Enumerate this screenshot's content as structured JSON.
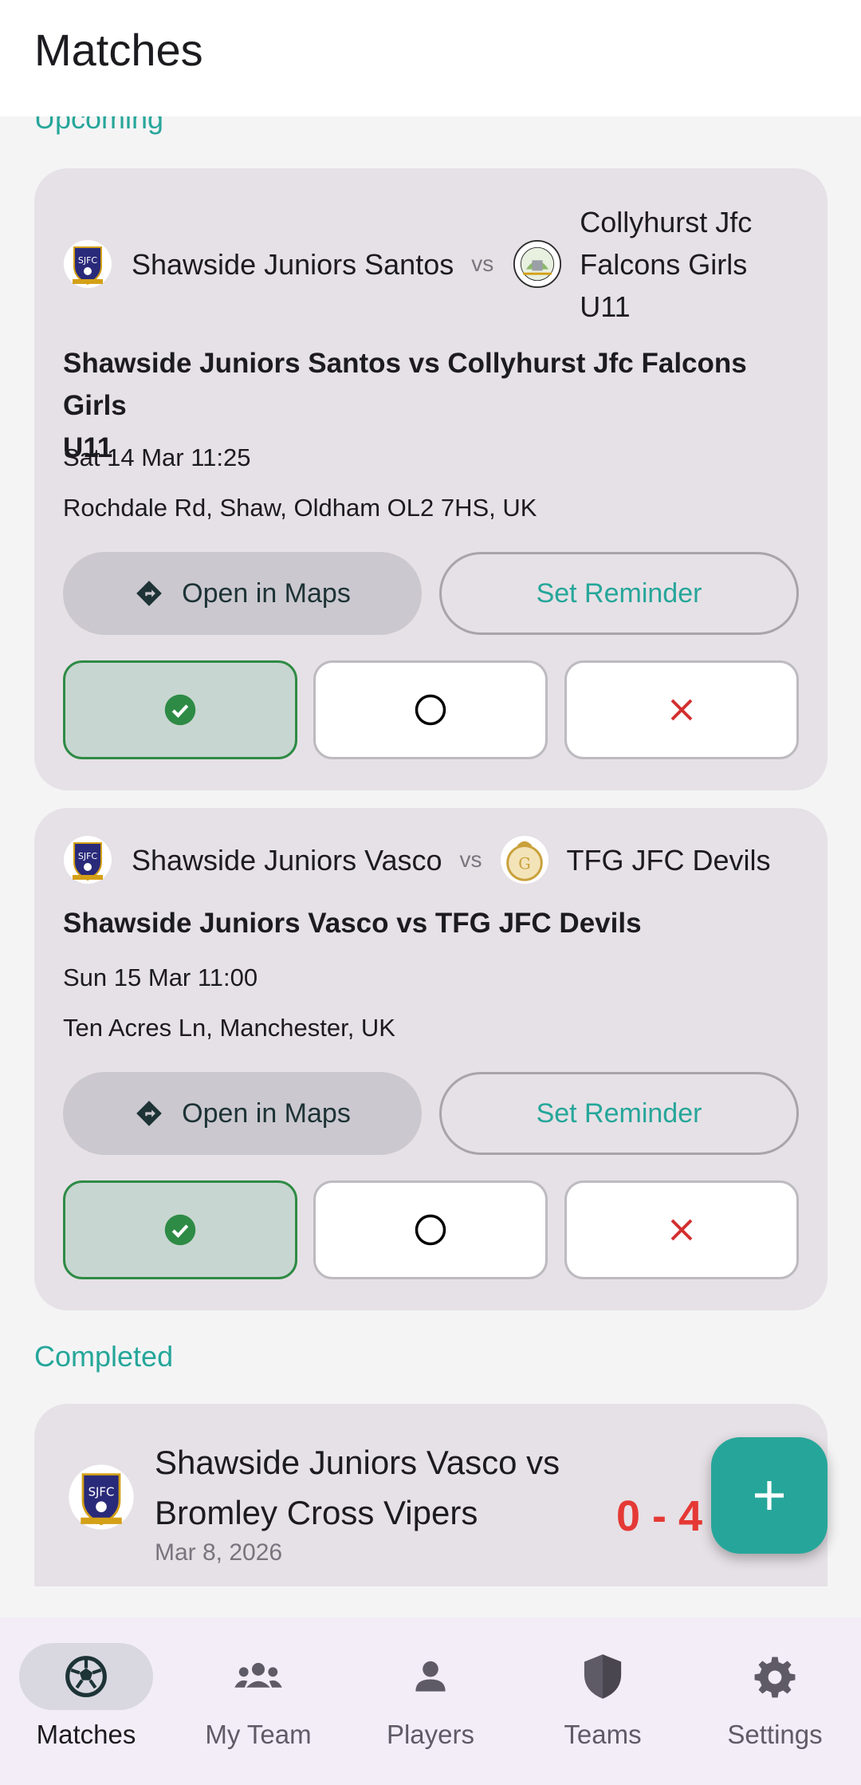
{
  "appbar": {
    "title": "Matches"
  },
  "sections": {
    "upcoming": "Upcoming",
    "completed": "Completed"
  },
  "upcoming": [
    {
      "home_team": "Shawside Juniors Santos",
      "away_team_lines": [
        "Collyhurst Jfc",
        "Falcons Girls",
        "U11"
      ],
      "vs": "vs",
      "title_lines": [
        "Shawside Juniors Santos vs Collyhurst Jfc Falcons Girls",
        "U11"
      ],
      "datetime": "Sat 14 Mar 11:25",
      "location": "Rochdale Rd, Shaw, Oldham OL2 7HS, UK",
      "maps_label": "Open in Maps",
      "reminder_label": "Set Reminder"
    },
    {
      "home_team": "Shawside Juniors Vasco",
      "away_team": "TFG JFC Devils",
      "vs": "vs",
      "title": "Shawside Juniors Vasco vs TFG JFC Devils",
      "datetime": "Sun 15 Mar 11:00",
      "location": "Ten Acres Ln, Manchester, UK",
      "maps_label": "Open in Maps",
      "reminder_label": "Set Reminder"
    }
  ],
  "completed": [
    {
      "title_lines": [
        "Shawside Juniors Vasco vs",
        "Bromley Cross Vipers"
      ],
      "date": "Mar 8, 2026",
      "score": "0 - 4"
    }
  ],
  "nav": [
    {
      "label": "Matches",
      "icon": "soccer-ball-icon",
      "active": true
    },
    {
      "label": "My Team",
      "icon": "group-icon",
      "active": false
    },
    {
      "label": "Players",
      "icon": "person-icon",
      "active": false
    },
    {
      "label": "Teams",
      "icon": "shield-icon",
      "active": false
    },
    {
      "label": "Settings",
      "icon": "gear-icon",
      "active": false
    }
  ],
  "colors": {
    "accent": "#26a69a",
    "score_loss": "#e53935",
    "available_green": "#2e8b45",
    "decline_red": "#d32f2f"
  }
}
